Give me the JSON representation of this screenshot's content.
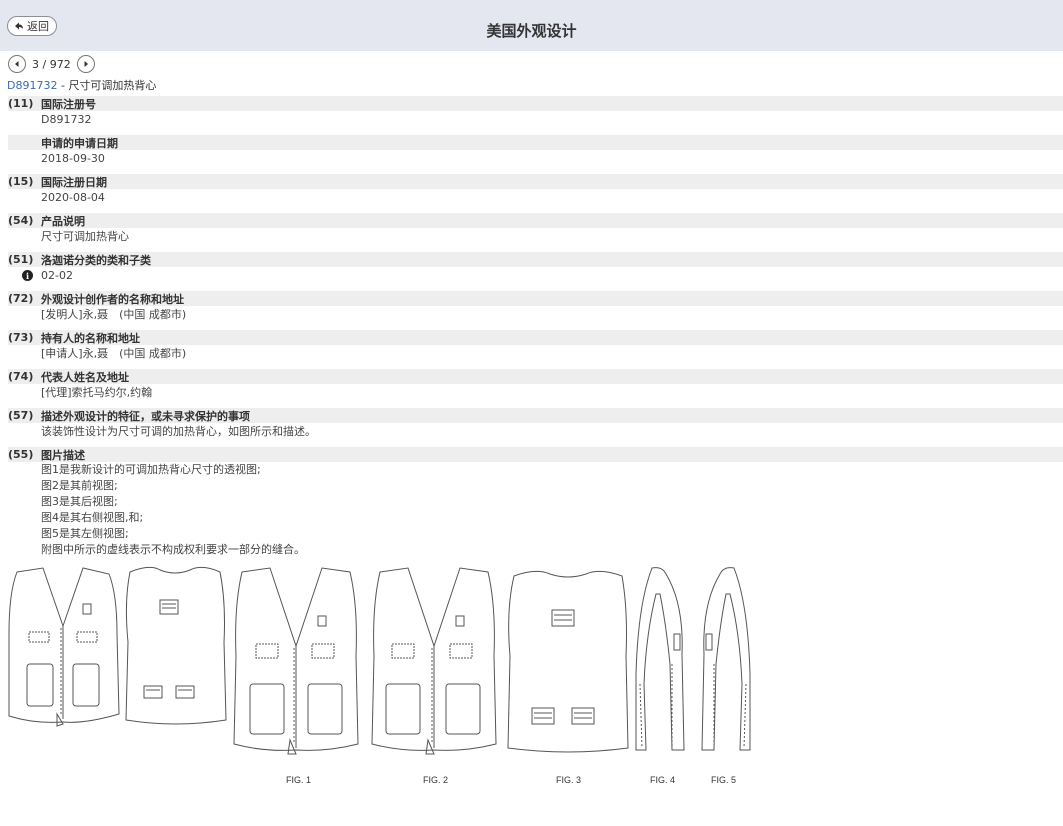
{
  "header": {
    "back_label": "返回",
    "title": "美国外观设计"
  },
  "pager": {
    "text": "3 / 972"
  },
  "record": {
    "id": "D891732",
    "separator": " - ",
    "name": "尺寸可调加热背心"
  },
  "fields": [
    {
      "code": "(11)",
      "label": "国际注册号",
      "values": [
        "D891732"
      ]
    },
    {
      "code": "",
      "label": "申请的申请日期",
      "values": [
        "2018-09-30"
      ]
    },
    {
      "code": "(15)",
      "label": "国际注册日期",
      "values": [
        "2020-08-04"
      ]
    },
    {
      "code": "(54)",
      "label": "产品说明",
      "values": [
        "尺寸可调加热背心"
      ]
    },
    {
      "code": "(51)",
      "label": "洛迦诺分类的类和子类",
      "values": [
        "02-02"
      ]
    },
    {
      "code": "(72)",
      "label": "外观设计创作者的名称和地址",
      "values": [
        "[发明人]永,聂　(中国 成都市)"
      ]
    },
    {
      "code": "(73)",
      "label": "持有人的名称和地址",
      "values": [
        "[申请人]永,聂　(中国 成都市)"
      ]
    },
    {
      "code": "(74)",
      "label": "代表人姓名及地址",
      "values": [
        "[代理]索托马约尔,约翰"
      ]
    },
    {
      "code": "(57)",
      "label": "描述外观设计的特征，或未寻求保护的事项",
      "values": [
        "该装饰性设计为尺寸可调的加热背心，如图所示和描述。"
      ]
    },
    {
      "code": "(55)",
      "label": "图片描述",
      "values": [
        "图1是我新设计的可调加热背心尺寸的透视图;",
        "图2是其前视图;",
        "图3是其后视图;",
        "图4是其右侧视图,和;",
        "图5是其左侧视图;",
        "附图中所示的虚线表示不构成权利要求一部分的缝合。"
      ]
    }
  ],
  "figure_labels": [
    "FIG. 1",
    "FIG. 2",
    "FIG. 3",
    "FIG. 4",
    "FIG. 5"
  ],
  "icons": {
    "back": "back-arrow-icon",
    "prev": "prev-page-icon",
    "next": "next-page-icon",
    "info": "info-icon"
  },
  "colors": {
    "topbar": "#e4e7f0",
    "field_header": "#eeeeee",
    "link": "#3a6bb5"
  }
}
